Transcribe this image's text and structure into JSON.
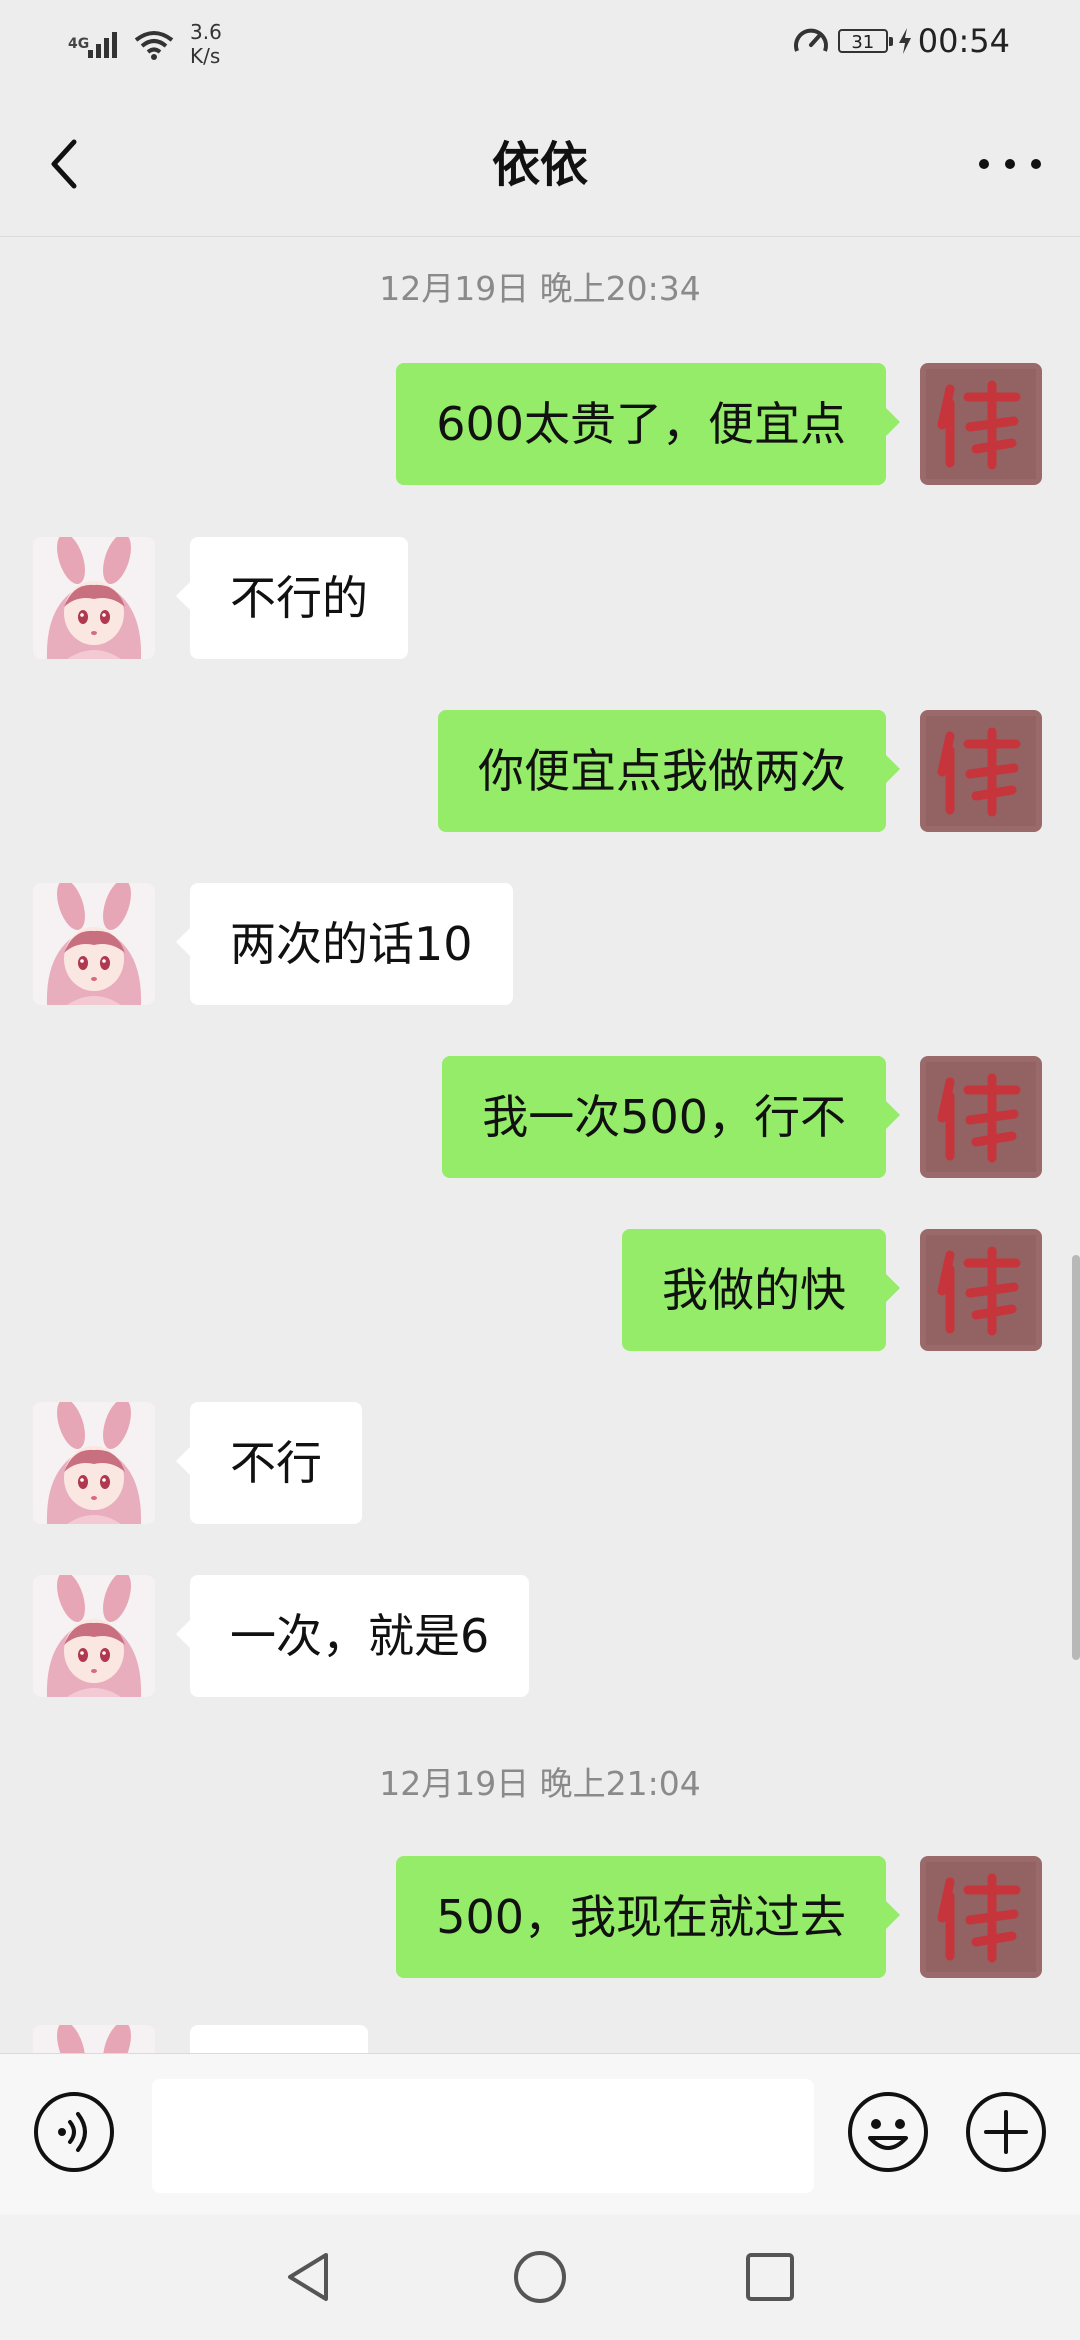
{
  "status_bar": {
    "network_type": "4G",
    "net_speed_value": "3.6",
    "net_speed_unit": "K/s",
    "battery_level": "31",
    "time": "00:54"
  },
  "header": {
    "title": "依依",
    "back_icon": "chevron-left-icon",
    "more_icon": "more-dots-icon"
  },
  "chat": {
    "timestamps": [
      "12月19日 晚上20:34",
      "12月19日 晚上21:04"
    ],
    "messages": [
      {
        "side": "right",
        "text": "600太贵了，便宜点"
      },
      {
        "side": "left",
        "text": "不行的"
      },
      {
        "side": "right",
        "text": "你便宜点我做两次"
      },
      {
        "side": "left",
        "text": "两次的话10"
      },
      {
        "side": "right",
        "text": "我一次500，行不"
      },
      {
        "side": "right",
        "text": "我做的快"
      },
      {
        "side": "left",
        "text": "不行"
      },
      {
        "side": "left",
        "text": "一次，就是6"
      },
      {
        "side": "right",
        "text": "500，我现在就过去"
      }
    ]
  },
  "input_bar": {
    "value": "",
    "voice_icon": "voice-icon",
    "emoji_icon": "emoji-icon",
    "plus_icon": "plus-icon"
  },
  "colors": {
    "background": "#ededed",
    "sent_bubble": "#95ec69",
    "received_bubble": "#ffffff",
    "timestamp_text": "#8a8a8a"
  }
}
